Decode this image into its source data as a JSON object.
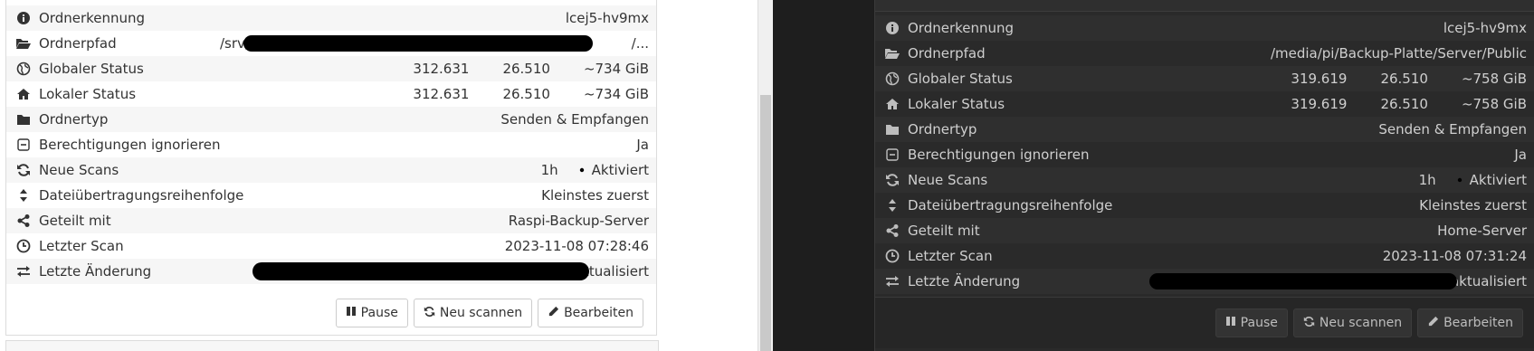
{
  "left": {
    "rows": [
      {
        "label": "Ordnerkennung",
        "value": "lcej5-hv9mx",
        "icon": "info-icon"
      },
      {
        "label": "Ordnerpfad",
        "value": "/srv/e",
        "value_tail": "/...",
        "icon": "folder-open-icon"
      },
      {
        "label": "Globaler Status",
        "files": "312.631",
        "folders": "26.510",
        "size": "~734 GiB",
        "icon": "globe-icon"
      },
      {
        "label": "Lokaler Status",
        "files": "312.631",
        "folders": "26.510",
        "size": "~734 GiB",
        "icon": "home-icon"
      },
      {
        "label": "Ordnertyp",
        "value": "Senden & Empfangen",
        "icon": "folder-icon"
      },
      {
        "label": "Berechtigungen ignorieren",
        "value": "Ja",
        "icon": "minus-square-icon"
      },
      {
        "label": "Neue Scans",
        "interval": "1h",
        "watch": "Aktiviert",
        "icon": "refresh-icon"
      },
      {
        "label": "Dateiübertragungsreihenfolge",
        "value": "Kleinstes zuerst",
        "icon": "sort-icon"
      },
      {
        "label": "Geteilt mit",
        "value": "Raspi-Backup-Server",
        "icon": "share-icon"
      },
      {
        "label": "Letzter Scan",
        "value": "2023-11-08 07:28:46",
        "icon": "clock-icon"
      },
      {
        "label": "Letzte Änderung",
        "value": "aktualisiert",
        "icon": "exchange-icon"
      }
    ],
    "buttons": {
      "pause": "Pause",
      "rescan": "Neu scannen",
      "edit": "Bearbeiten"
    }
  },
  "right": {
    "rows": [
      {
        "label": "Ordnerkennung",
        "value": "lcej5-hv9mx",
        "icon": "info-icon"
      },
      {
        "label": "Ordnerpfad",
        "value": "/media/pi/Backup-Platte/Server/Public",
        "icon": "folder-open-icon"
      },
      {
        "label": "Globaler Status",
        "files": "319.619",
        "folders": "26.510",
        "size": "~758 GiB",
        "icon": "globe-icon"
      },
      {
        "label": "Lokaler Status",
        "files": "319.619",
        "folders": "26.510",
        "size": "~758 GiB",
        "icon": "home-icon"
      },
      {
        "label": "Ordnertyp",
        "value": "Senden & Empfangen",
        "icon": "folder-icon"
      },
      {
        "label": "Berechtigungen ignorieren",
        "value": "Ja",
        "icon": "minus-square-icon"
      },
      {
        "label": "Neue Scans",
        "interval": "1h",
        "watch": "Aktiviert",
        "icon": "refresh-icon"
      },
      {
        "label": "Dateiübertragungsreihenfolge",
        "value": "Kleinstes zuerst",
        "icon": "sort-icon"
      },
      {
        "label": "Geteilt mit",
        "value": "Home-Server",
        "icon": "share-icon"
      },
      {
        "label": "Letzter Scan",
        "value": "2023-11-08 07:31:24",
        "icon": "clock-icon"
      },
      {
        "label": "Letzte Änderung",
        "value": "aktualisiert",
        "icon": "exchange-icon"
      }
    ],
    "buttons": {
      "pause": "Pause",
      "rescan": "Neu scannen",
      "edit": "Bearbeiten"
    }
  }
}
